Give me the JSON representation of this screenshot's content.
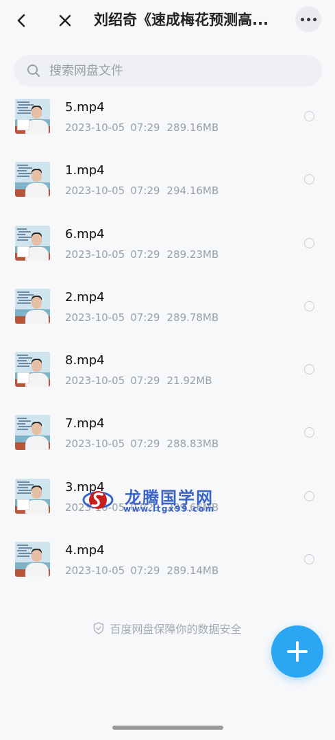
{
  "header": {
    "title": "刘绍奇《速成梅花预测高...",
    "back_icon": "chevron-left-icon",
    "close_icon": "close-icon",
    "more_icon": "more-icon"
  },
  "search": {
    "placeholder": "搜索网盘文件",
    "icon": "search-icon"
  },
  "files": [
    {
      "name": "5.mp4",
      "date": "2023-10-05",
      "time": "07:29",
      "size": "289.16MB"
    },
    {
      "name": "1.mp4",
      "date": "2023-10-05",
      "time": "07:29",
      "size": "294.16MB"
    },
    {
      "name": "6.mp4",
      "date": "2023-10-05",
      "time": "07:29",
      "size": "289.23MB"
    },
    {
      "name": "2.mp4",
      "date": "2023-10-05",
      "time": "07:29",
      "size": "289.78MB"
    },
    {
      "name": "8.mp4",
      "date": "2023-10-05",
      "time": "07:29",
      "size": "21.92MB"
    },
    {
      "name": "7.mp4",
      "date": "2023-10-05",
      "time": "07:29",
      "size": "288.83MB"
    },
    {
      "name": "3.mp4",
      "date": "2023-10-05",
      "time": "07:29",
      "size": "289.66MB"
    },
    {
      "name": "4.mp4",
      "date": "2023-10-05",
      "time": "07:29",
      "size": "289.14MB"
    }
  ],
  "watermark": {
    "name": "龙腾国学网",
    "url": "www.ltgx99.com"
  },
  "footer": {
    "security_note": "百度网盘保障你的数据安全"
  },
  "colors": {
    "accent": "#2aa6f3",
    "background": "#f7f8fa",
    "meta_text": "#9aa0a8"
  }
}
